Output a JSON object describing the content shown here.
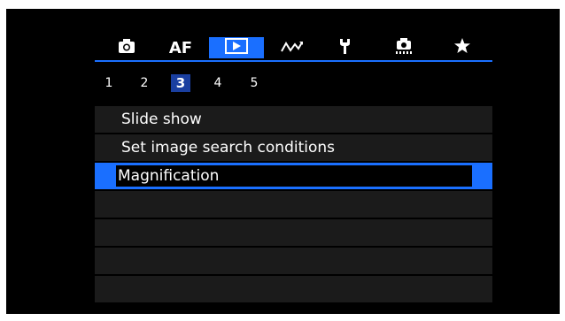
{
  "tabs": [
    {
      "icon": "camera-icon",
      "active": false
    },
    {
      "label": "AF",
      "active": false
    },
    {
      "icon": "play-icon",
      "active": true
    },
    {
      "icon": "wireless-icon",
      "active": false
    },
    {
      "icon": "wrench-icon",
      "active": false
    },
    {
      "icon": "custom-function-icon",
      "active": false
    },
    {
      "icon": "star-icon",
      "active": false
    }
  ],
  "pages": [
    "1",
    "2",
    "3",
    "4",
    "5"
  ],
  "active_page": "3",
  "menu": {
    "items": [
      "Slide show",
      "Set image search conditions",
      "Magnification",
      "",
      "",
      "",
      ""
    ],
    "selected_index": 2
  },
  "colors": {
    "accent": "#1a6fff",
    "row_bg": "#1b1b1b",
    "screen_bg": "#000000"
  }
}
